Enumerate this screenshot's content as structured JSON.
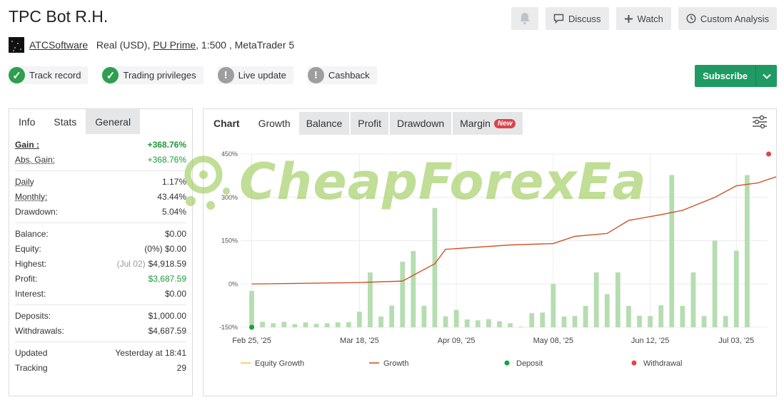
{
  "header": {
    "title": "TPC Bot R.H.",
    "buttons": {
      "discuss": "Discuss",
      "watch": "Watch",
      "custom": "Custom Analysis"
    }
  },
  "meta": {
    "author": "ATCSoftware",
    "account": "Real (USD),",
    "broker": "PU Prime",
    "details": " , 1:500 , MetaTrader 5"
  },
  "badges": [
    {
      "label": "Track record",
      "status": "ok"
    },
    {
      "label": "Trading privileges",
      "status": "ok"
    },
    {
      "label": "Live update",
      "status": "warn"
    },
    {
      "label": "Cashback",
      "status": "warn"
    }
  ],
  "subscribe": {
    "label": "Subscribe"
  },
  "left_tabs": {
    "info": "Info",
    "stats": "Stats",
    "general": "General"
  },
  "stats": {
    "gain": {
      "k": "Gain :",
      "v": "+368.76%"
    },
    "abs_gain": {
      "k": "Abs. Gain:",
      "v": "+368.76%"
    },
    "daily": {
      "k": "Daily",
      "v": "1.17%"
    },
    "monthly": {
      "k": "Monthly:",
      "v": "43.44%"
    },
    "drawdown": {
      "k": "Drawdown:",
      "v": "5.04%"
    },
    "balance": {
      "k": "Balance:",
      "v": "$0.00"
    },
    "equity": {
      "k": "Equity:",
      "pre": "(0%)",
      "v": "$0.00"
    },
    "highest": {
      "k": "Highest:",
      "pre": "(Jul 02)",
      "v": "$4,918.59"
    },
    "profit": {
      "k": "Profit:",
      "v": "$3,687.59"
    },
    "interest": {
      "k": "Interest:",
      "v": "$0.00"
    },
    "deposits": {
      "k": "Deposits:",
      "v": "$1,000.00"
    },
    "withdrawals": {
      "k": "Withdrawals:",
      "v": "$4,687.59"
    },
    "updated": {
      "k": "Updated",
      "v": "Yesterday at 18:41"
    },
    "tracking": {
      "k": "Tracking",
      "v": "29"
    }
  },
  "chart_tabs": {
    "chart": "Chart",
    "growth": "Growth",
    "balance": "Balance",
    "profit": "Profit",
    "drawdown": "Drawdown",
    "margin": "Margin",
    "new": "New"
  },
  "watermark": "CheapForexEa",
  "colors": {
    "bar": "#b5ddb0",
    "line": "#cc4a1c",
    "deposit": "#15a339",
    "withdrawal": "#e04545",
    "equity": "#f0c23a"
  },
  "chart_data": {
    "type": "bar",
    "ylim": [
      -150,
      450
    ],
    "yticks": [
      "450%",
      "300%",
      "150%",
      "0%",
      "-150%"
    ],
    "ytick_values": [
      450,
      300,
      150,
      0,
      -150
    ],
    "xtick_labels": [
      "Feb 25, '25",
      "Mar 18, '25",
      "Apr 09, '25",
      "May 08, '25",
      "Jun 12, '25",
      "Jul 03, '25"
    ],
    "xtick_index": [
      0,
      10,
      19,
      28,
      37,
      45
    ],
    "bars": [
      -24,
      -131,
      -136,
      -131,
      -139,
      -133,
      -138,
      -136,
      -133,
      -132,
      -96,
      40,
      -113,
      -75,
      77,
      114,
      -76,
      263,
      -112,
      -90,
      -123,
      -126,
      -122,
      -129,
      -136,
      -148,
      -101,
      -99,
      0,
      -113,
      -111,
      -76,
      40,
      -35,
      40,
      -76,
      -110,
      -111,
      -74,
      377,
      -76,
      40,
      -111,
      150,
      -111,
      115,
      377
    ],
    "growth_line": [
      [
        0,
        0
      ],
      [
        10,
        5
      ],
      [
        14,
        10
      ],
      [
        17,
        70
      ],
      [
        18,
        120
      ],
      [
        24,
        135
      ],
      [
        28,
        140
      ],
      [
        30,
        165
      ],
      [
        33,
        175
      ],
      [
        35,
        220
      ],
      [
        38,
        240
      ],
      [
        40,
        255
      ],
      [
        43,
        300
      ],
      [
        45,
        340
      ],
      [
        47,
        350
      ],
      [
        49,
        375
      ]
    ],
    "deposit": {
      "index": 0,
      "value": -150
    },
    "withdrawal": {
      "index": 48,
      "value": 450
    },
    "legend": [
      "Equity Growth",
      "Growth",
      "Deposit",
      "Withdrawal"
    ]
  }
}
